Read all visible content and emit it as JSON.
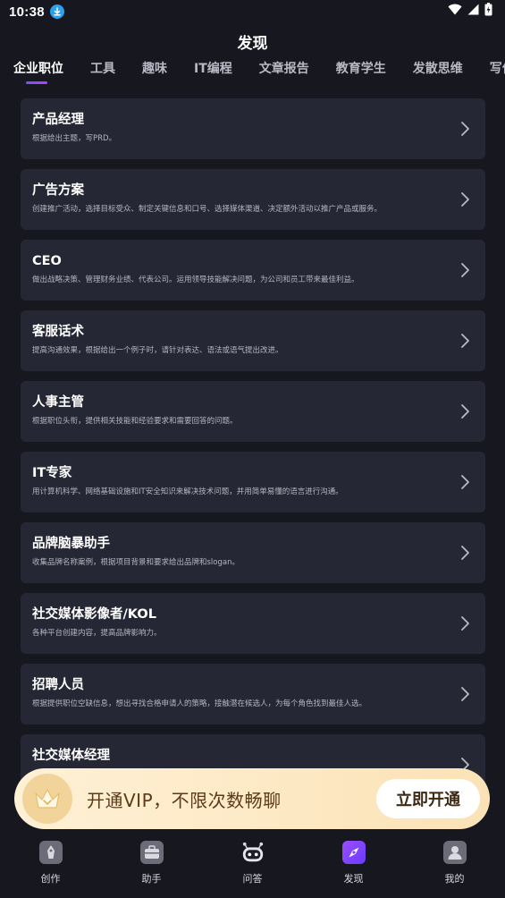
{
  "status_bar": {
    "time": "10:38"
  },
  "header": {
    "title": "发现"
  },
  "tabs": [
    {
      "label": "企业职位",
      "active": true
    },
    {
      "label": "工具",
      "active": false
    },
    {
      "label": "趣味",
      "active": false
    },
    {
      "label": "IT编程",
      "active": false
    },
    {
      "label": "文章报告",
      "active": false
    },
    {
      "label": "教育学生",
      "active": false
    },
    {
      "label": "发散思维",
      "active": false
    },
    {
      "label": "写作辅",
      "active": false
    }
  ],
  "cards": [
    {
      "title": "产品经理",
      "desc": "根据给出主题，写PRD。"
    },
    {
      "title": "广告方案",
      "desc": "创建推广活动，选择目标受众、制定关键信息和口号、选择媒体渠道、决定额外活动以推广产品或服务。"
    },
    {
      "title": "CEO",
      "desc": "做出战略决策、管理财务业绩、代表公司。运用领导技能解决问题，为公司和员工带来最佳利益。"
    },
    {
      "title": "客服话术",
      "desc": "提高沟通效果，根据给出一个例子时，请针对表达、语法或语气提出改进。"
    },
    {
      "title": "人事主管",
      "desc": "根据职位头衔，提供相关技能和经验要求和需要回答的问题。"
    },
    {
      "title": "IT专家",
      "desc": "用计算机科学、网络基础设施和IT安全知识来解决技术问题，并用简单易懂的语言进行沟通。"
    },
    {
      "title": "品牌脑暴助手",
      "desc": "收集品牌名称案例，根据项目背景和要求给出品牌和slogan。"
    },
    {
      "title": "社交媒体影像者/KOL",
      "desc": "各种平台创建内容，提高品牌影响力。"
    },
    {
      "title": "招聘人员",
      "desc": "根据提供职位空缺信息，想出寻找合格申请人的策略，接触潜在候选人，为每个角色找到最佳人选。"
    },
    {
      "title": "社交媒体经理",
      "desc": ""
    }
  ],
  "vip_banner": {
    "text": "开通VIP，不限次数畅聊",
    "button": "立即开通"
  },
  "bottom_nav": [
    {
      "label": "创作",
      "icon": "pen-icon"
    },
    {
      "label": "助手",
      "icon": "briefcase-icon"
    },
    {
      "label": "问答",
      "icon": "robot-icon"
    },
    {
      "label": "发现",
      "icon": "compass-icon",
      "active": true
    },
    {
      "label": "我的",
      "icon": "user-icon"
    }
  ],
  "colors": {
    "background": "#16171f",
    "card": "#262734",
    "accent": "#8a4dff",
    "vip_text": "#5b3a17"
  }
}
